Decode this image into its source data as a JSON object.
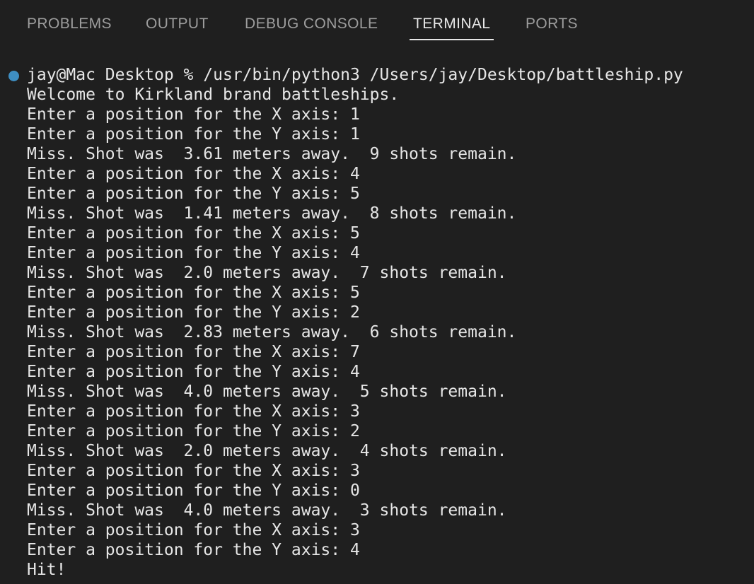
{
  "tabs": [
    {
      "label": "PROBLEMS",
      "active": false
    },
    {
      "label": "OUTPUT",
      "active": false
    },
    {
      "label": "DEBUG CONSOLE",
      "active": false
    },
    {
      "label": "TERMINAL",
      "active": true
    },
    {
      "label": "PORTS",
      "active": false
    }
  ],
  "terminal": {
    "status_dot_color": "#3e8ec2",
    "lines": [
      "jay@Mac Desktop % /usr/bin/python3 /Users/jay/Desktop/battleship.py",
      "Welcome to Kirkland brand battleships.",
      "Enter a position for the X axis: 1",
      "Enter a position for the Y axis: 1",
      "Miss. Shot was  3.61 meters away.  9 shots remain.",
      "Enter a position for the X axis: 4",
      "Enter a position for the Y axis: 5",
      "Miss. Shot was  1.41 meters away.  8 shots remain.",
      "Enter a position for the X axis: 5",
      "Enter a position for the Y axis: 4",
      "Miss. Shot was  2.0 meters away.  7 shots remain.",
      "Enter a position for the X axis: 5",
      "Enter a position for the Y axis: 2",
      "Miss. Shot was  2.83 meters away.  6 shots remain.",
      "Enter a position for the X axis: 7",
      "Enter a position for the Y axis: 4",
      "Miss. Shot was  4.0 meters away.  5 shots remain.",
      "Enter a position for the X axis: 3",
      "Enter a position for the Y axis: 2",
      "Miss. Shot was  2.0 meters away.  4 shots remain.",
      "Enter a position for the X axis: 3",
      "Enter a position for the Y axis: 0",
      "Miss. Shot was  4.0 meters away.  3 shots remain.",
      "Enter a position for the X axis: 3",
      "Enter a position for the Y axis: 4",
      "Hit!"
    ]
  }
}
